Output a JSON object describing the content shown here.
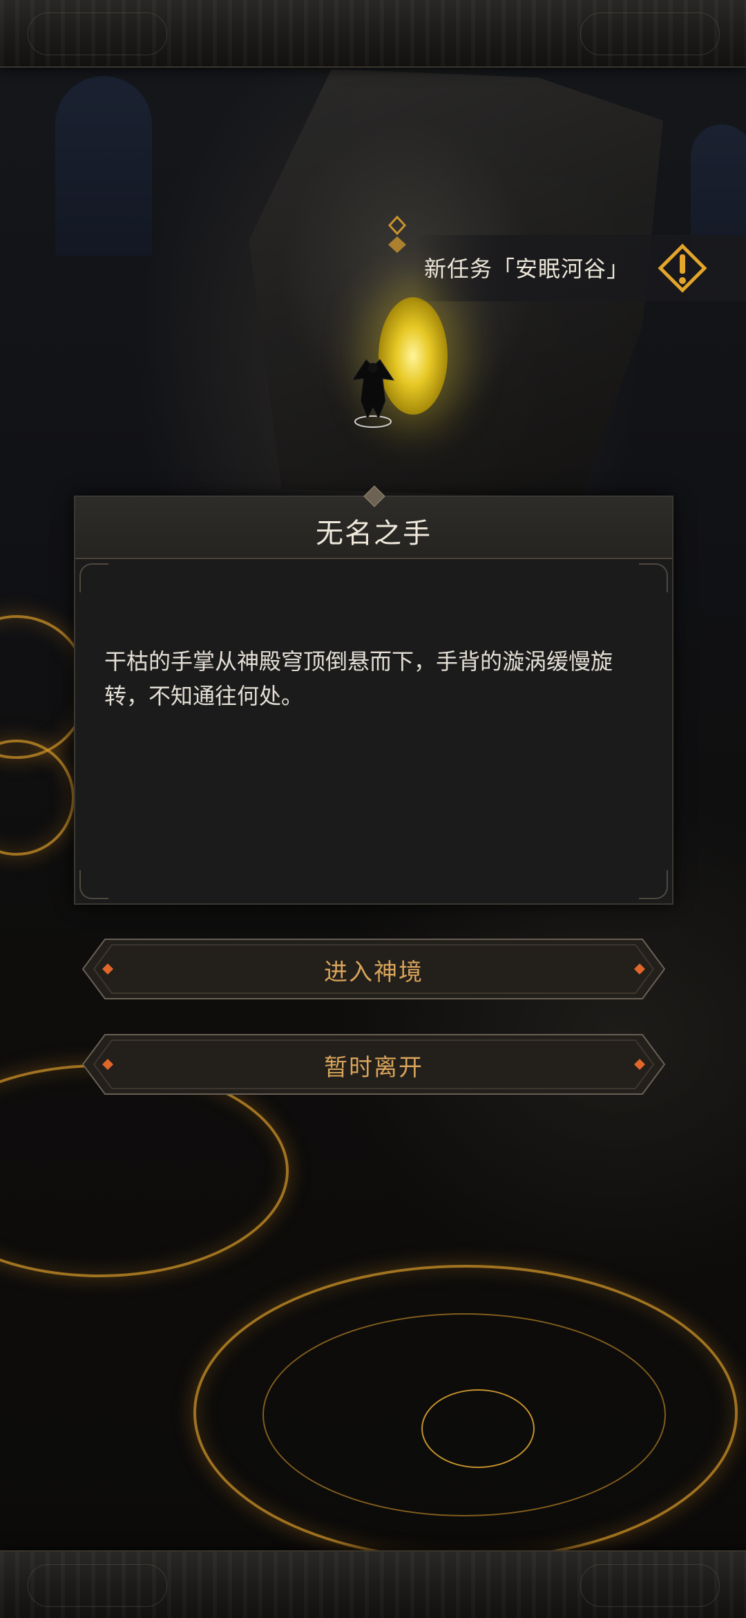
{
  "quest_notice": {
    "text": "新任务「安眠河谷」",
    "icon": "warning-icon"
  },
  "event_panel": {
    "title": "无名之手",
    "description": "干枯的手掌从神殿穹顶倒悬而下，手背的漩涡缓慢旋转，不知通往何处。"
  },
  "choices": [
    {
      "label": "进入神境"
    },
    {
      "label": "暂时离开"
    }
  ],
  "colors": {
    "accent_gold": "#d7a45a",
    "rune_orange": "#d29628",
    "button_gem": "#e0672a",
    "panel_bg": "#1b1b1c"
  }
}
